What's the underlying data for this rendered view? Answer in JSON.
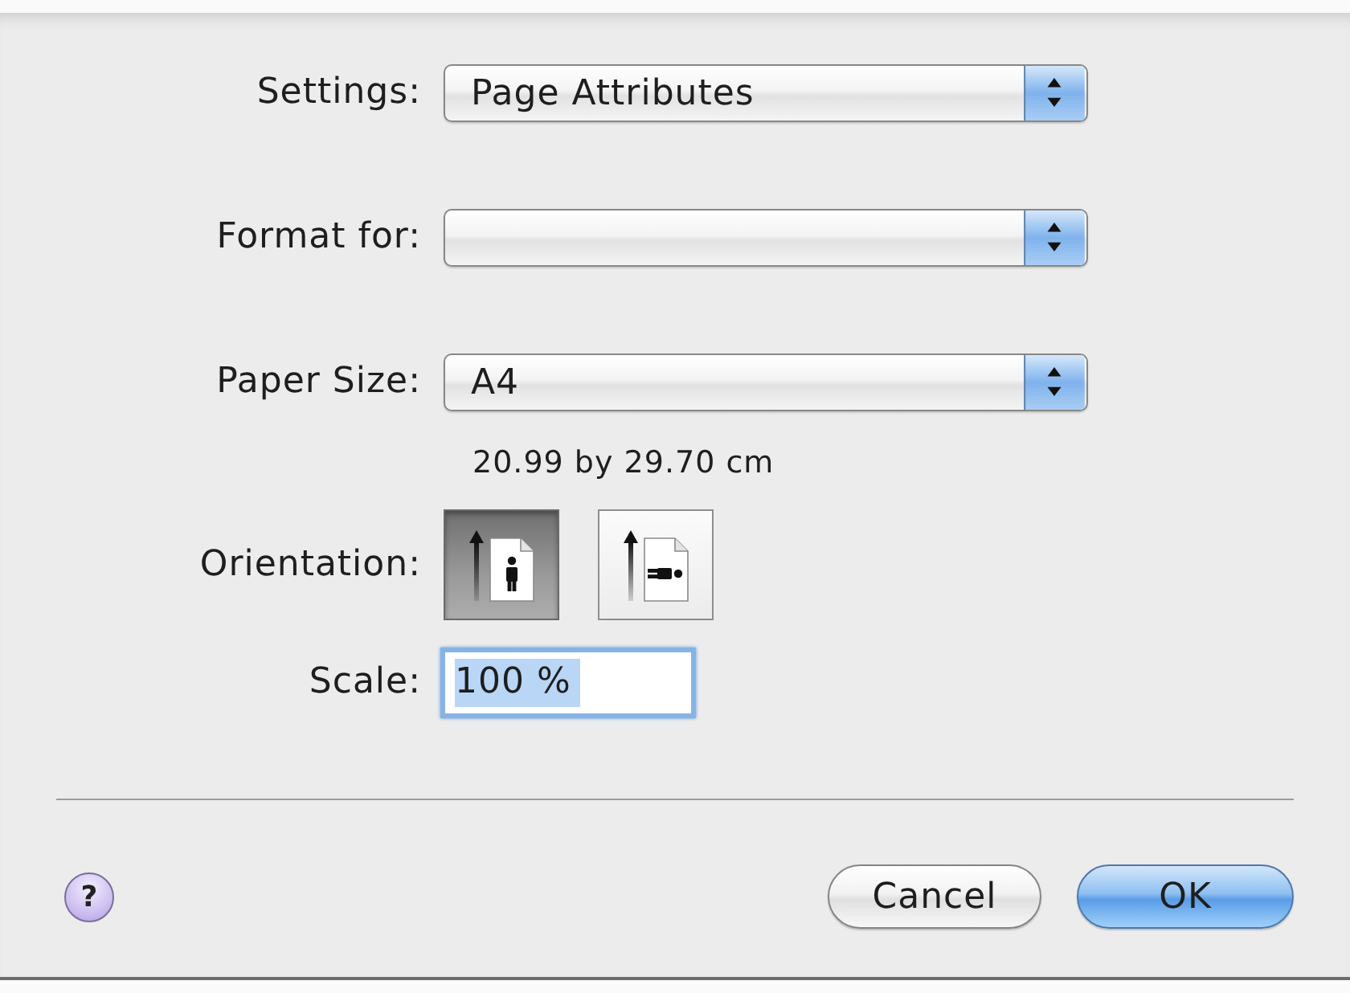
{
  "fields": [
    {
      "kind": "popup",
      "label": "Settings:",
      "value": "Page Attributes"
    },
    {
      "kind": "popup",
      "label": "Format for:"
    },
    {
      "kind": "popup",
      "label": "Paper Size:",
      "value": "A4",
      "note": "20.99 by 29.70 cm"
    },
    {
      "kind": "orientation",
      "label": "Orientation:",
      "options": [
        {
          "kind": "portrait",
          "selected": true
        },
        {
          "kind": "landscape",
          "selected": false
        }
      ]
    },
    {
      "kind": "text",
      "label": "Scale:",
      "value": "100 %",
      "focused": true
    }
  ],
  "help_button": {
    "label": "?"
  },
  "buttons": [
    {
      "label": "Cancel",
      "default": false
    },
    {
      "label": "OK",
      "default": true
    }
  ]
}
